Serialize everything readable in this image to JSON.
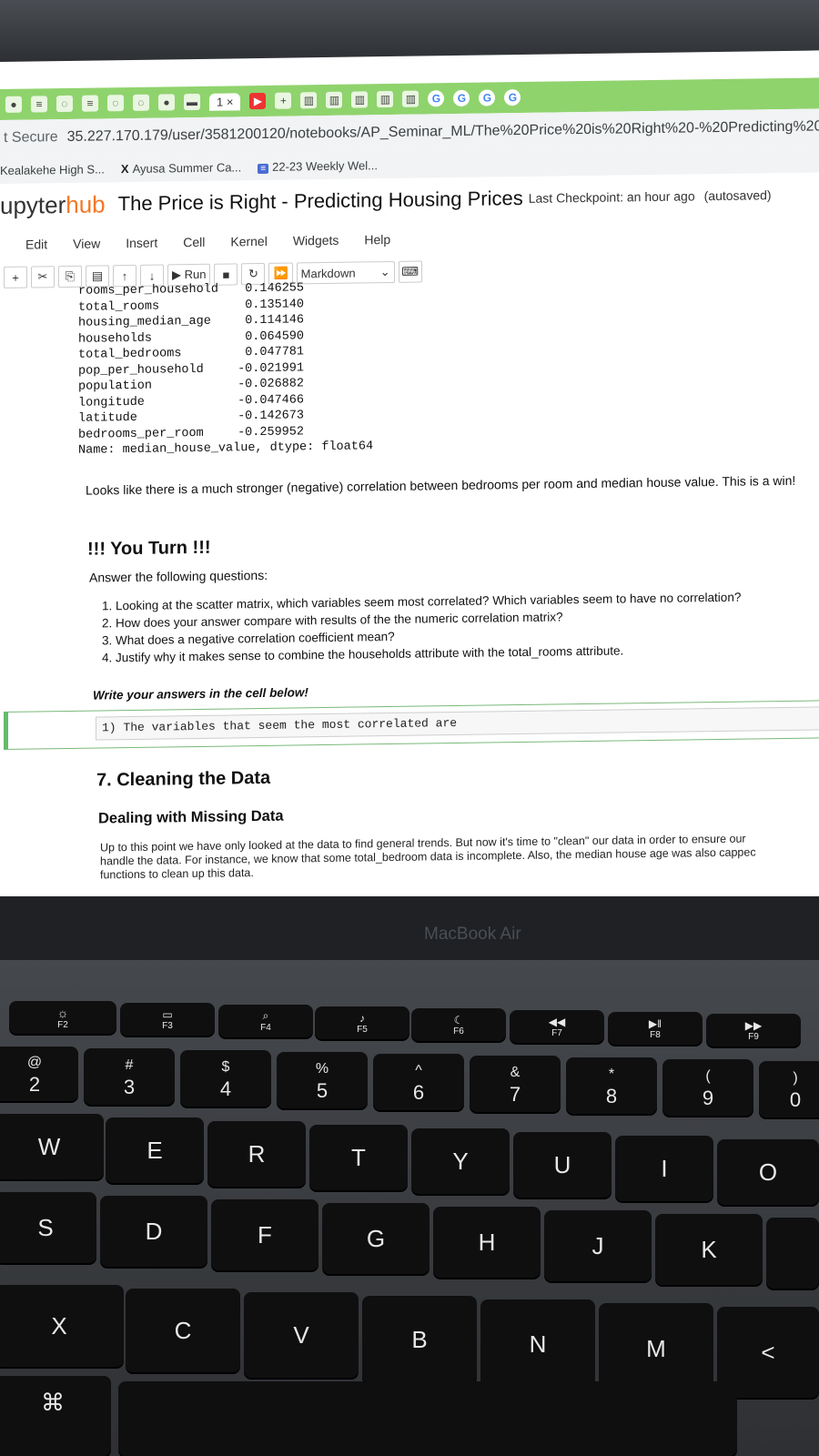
{
  "browser": {
    "tab_active_label": "1 ×",
    "security_label": "t Secure",
    "url": "35.227.170.179/user/3581200120/notebooks/AP_Seminar_ML/The%20Price%20is%20Right%20-%20Predicting%20H",
    "bookmarks": [
      {
        "label": "Kealakehe High S..."
      },
      {
        "label": "Ayusa Summer Ca..."
      },
      {
        "label": "22-23 Weekly Wel..."
      }
    ]
  },
  "jupyter": {
    "logo": "upyter",
    "logo_hub": "hub",
    "notebook_title": "The Price is Right - Predicting Housing Prices",
    "checkpoint": "Last Checkpoint: an hour ago",
    "autosave": "(autosaved)",
    "menu": [
      "Edit",
      "View",
      "Insert",
      "Cell",
      "Kernel",
      "Widgets",
      "Help"
    ],
    "toolbar": {
      "run_label": "▶ Run",
      "cell_type": "Markdown"
    }
  },
  "notebook": {
    "output_rows": [
      {
        "name": "rooms_per_household",
        "value": "0.146255"
      },
      {
        "name": "total_rooms",
        "value": "0.135140"
      },
      {
        "name": "housing_median_age",
        "value": "0.114146"
      },
      {
        "name": "households",
        "value": "0.064590"
      },
      {
        "name": "total_bedrooms",
        "value": "0.047781"
      },
      {
        "name": "pop_per_household",
        "value": "-0.021991"
      },
      {
        "name": "population",
        "value": "-0.026882"
      },
      {
        "name": "longitude",
        "value": "-0.047466"
      },
      {
        "name": "latitude",
        "value": "-0.142673"
      },
      {
        "name": "bedrooms_per_room",
        "value": "-0.259952"
      }
    ],
    "output_footer": "Name: median_house_value, dtype: float64",
    "observation": "Looks like there is a much stronger (negative) correlation between bedrooms per room and median house value. This is a win!",
    "your_turn_heading": "!!! You Turn !!!",
    "answer_prompt": "Answer the following questions:",
    "questions": [
      "1. Looking at the scatter matrix, which variables seem most correlated? Which variables seem to have no correlation?",
      "2. How does your answer compare with results of the the numeric correlation matrix?",
      "3. What does a negative correlation coefficient mean?",
      "4. Justify why it makes sense to combine the households attribute with the total_rooms attribute."
    ],
    "write_below": "Write your answers in the cell below!",
    "cell_input": "1) The variables that seem the most correlated are",
    "section_heading": "7. Cleaning the Data",
    "subheading": "Dealing with Missing Data",
    "paragraph_lines": [
      "Up to this point we have only looked at the data to find general trends. But now it's time to \"clean\" our data in order to ensure our",
      "handle the data. For instance, we know that some total_bedroom data is incomplete. Also, the median house age was also cappec",
      "functions to clean up this data."
    ]
  },
  "laptop": {
    "brand_label": "MacBook Air",
    "fkeys": [
      {
        "label": "F2"
      },
      {
        "label": "F3"
      },
      {
        "label": "F4"
      },
      {
        "label": "F5"
      },
      {
        "label": "F6"
      },
      {
        "label": "F7"
      },
      {
        "label": "F8"
      },
      {
        "label": "F9"
      }
    ],
    "number_keys": [
      {
        "top": "@",
        "bottom": "2"
      },
      {
        "top": "#",
        "bottom": "3"
      },
      {
        "top": "$",
        "bottom": "4"
      },
      {
        "top": "%",
        "bottom": "5"
      },
      {
        "top": "^",
        "bottom": "6"
      },
      {
        "top": "&",
        "bottom": "7"
      },
      {
        "top": "*",
        "bottom": "8"
      },
      {
        "top": "(",
        "bottom": "9"
      },
      {
        "top": ")",
        "bottom": "0"
      }
    ],
    "row_qwerty": [
      "W",
      "E",
      "R",
      "T",
      "Y",
      "U",
      "I",
      "O"
    ],
    "row_home": [
      "S",
      "D",
      "F",
      "G",
      "H",
      "J",
      "K"
    ],
    "row_bottom": [
      "X",
      "C",
      "V",
      "B",
      "N",
      "M",
      "<"
    ],
    "cmd_symbol": "⌘"
  }
}
